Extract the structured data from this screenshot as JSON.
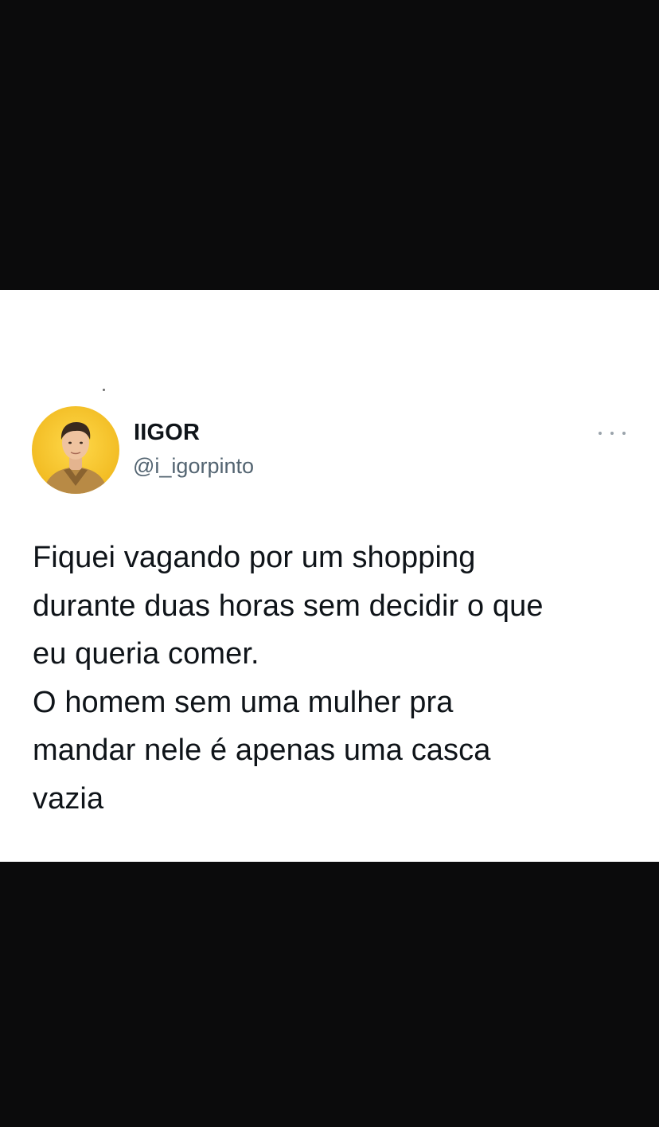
{
  "tweet": {
    "author": {
      "display_name": "IIGOR",
      "handle": "@i_igorpinto",
      "avatar_icon": "profile-photo"
    },
    "more_icon": "more-horizontal-icon",
    "text": "Fiquei vagando por um shopping\ndurante duas horas sem decidir o que\neu queria comer.\nO homem sem uma mulher pra\nmandar nele é apenas uma casca\nvazia"
  },
  "colors": {
    "band": "#0b0b0c",
    "card": "#ffffff",
    "name": "#0f1419",
    "handle": "#536471",
    "avatar_bg": "#f2c230"
  }
}
